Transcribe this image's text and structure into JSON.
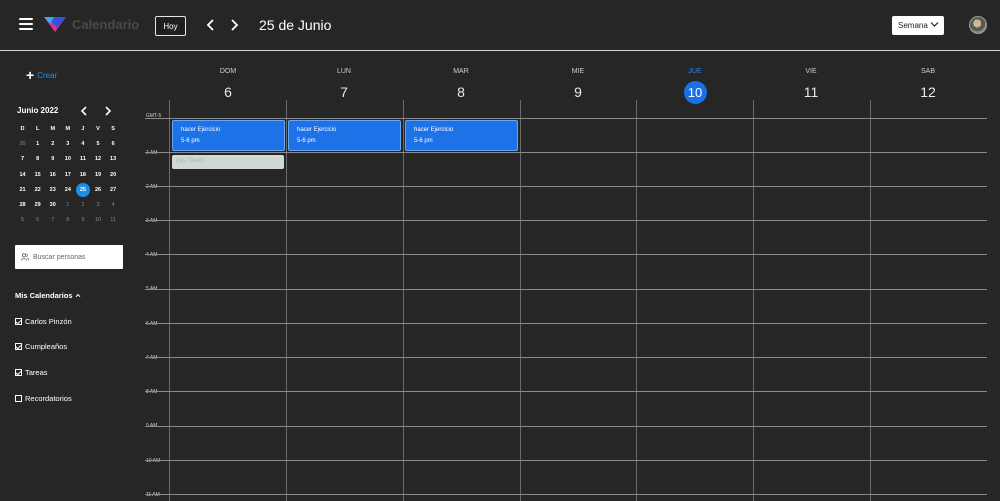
{
  "header": {
    "app_title": "Calendario",
    "today_label": "Hoy",
    "current_date": "25 de Junio",
    "view_label": "Semana"
  },
  "sidebar": {
    "create_label": "Crear",
    "mini_calendar": {
      "title": "Junio 2022",
      "weekdays": [
        "D",
        "L",
        "M",
        "M",
        "J",
        "V",
        "S"
      ],
      "weeks": [
        [
          "30",
          "1",
          "2",
          "3",
          "4",
          "5",
          "6"
        ],
        [
          "7",
          "8",
          "9",
          "10",
          "11",
          "12",
          "13"
        ],
        [
          "14",
          "15",
          "16",
          "17",
          "18",
          "19",
          "20"
        ],
        [
          "21",
          "22",
          "23",
          "24",
          "25",
          "26",
          "27"
        ],
        [
          "28",
          "29",
          "30",
          "1",
          "2",
          "3",
          "4"
        ],
        [
          "5",
          "6",
          "7",
          "8",
          "9",
          "10",
          "11"
        ]
      ],
      "selected_day": "25"
    },
    "search_placeholder": "Buscar personas",
    "my_calendars_label": "Mis Calendarios",
    "calendars": [
      {
        "label": "Carlos Pinzón",
        "checked": true
      },
      {
        "label": "Cumpleaños",
        "checked": true
      },
      {
        "label": "Tareas",
        "checked": true
      },
      {
        "label": "Recordatorios",
        "checked": false
      }
    ]
  },
  "week": {
    "days": [
      {
        "name": "DOM",
        "num": "6"
      },
      {
        "name": "LUN",
        "num": "7"
      },
      {
        "name": "MAR",
        "num": "8"
      },
      {
        "name": "MIE",
        "num": "9"
      },
      {
        "name": "JUE",
        "num": "10",
        "today": true
      },
      {
        "name": "VIE",
        "num": "11"
      },
      {
        "name": "SAB",
        "num": "12"
      }
    ],
    "timezone": "GMT-5",
    "hours": [
      "1 AM",
      "2 AM",
      "3 AM",
      "4 AM",
      "5 AM",
      "6 AM",
      "7 AM",
      "8 AM",
      "9 AM",
      "10 AM",
      "11 AM"
    ],
    "events": [
      {
        "title": "hacer Ejercicio",
        "time": "5-6 pm",
        "day": 0
      },
      {
        "title": "hacer Ejercicio",
        "time": "5-6 pm",
        "day": 1
      },
      {
        "title": "hacer Ejercicio",
        "time": "5-6 pm",
        "day": 2
      },
      {
        "title": "(sin Título)",
        "time": "",
        "day": 0
      }
    ]
  },
  "colors": {
    "accent": "#1e72e8",
    "today_circle": "#1b6fe8",
    "background": "#262626"
  }
}
